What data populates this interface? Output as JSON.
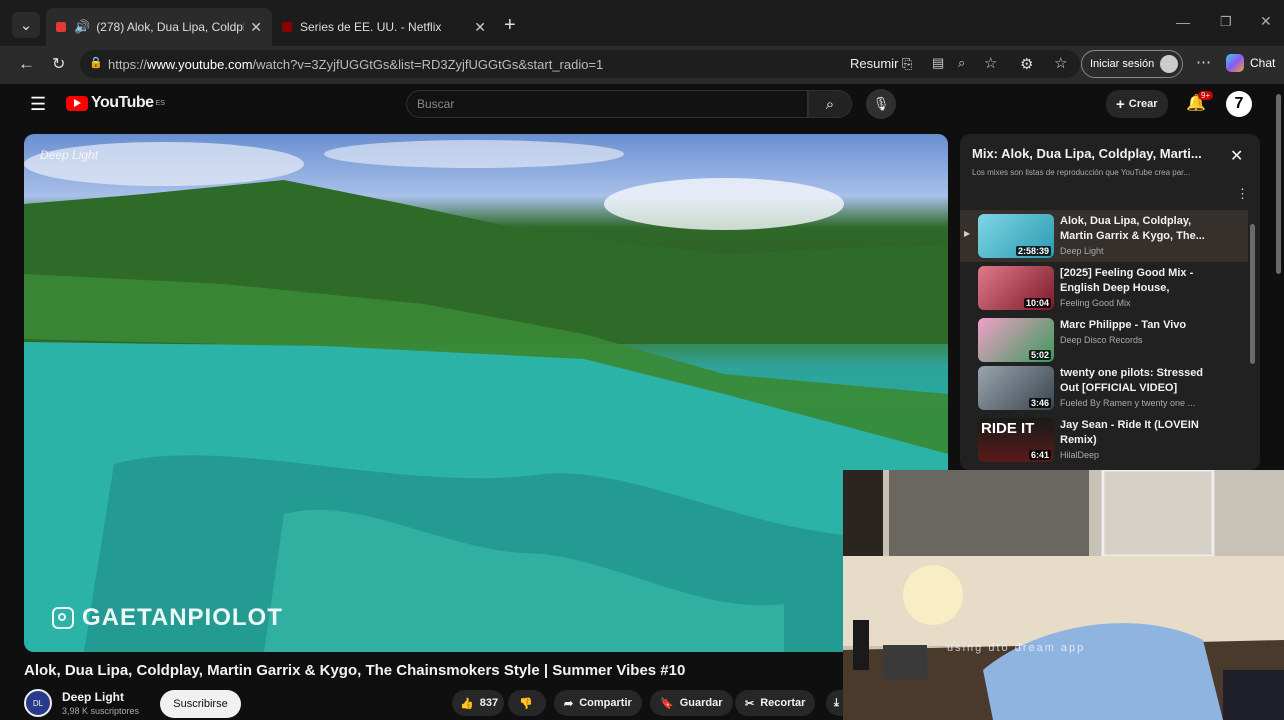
{
  "browser": {
    "tabs": [
      {
        "title": "(278) Alok, Dua Lipa, Coldplay",
        "active": true,
        "favicon_color": "#e53935"
      },
      {
        "title": "Series de EE. UU. - Netflix",
        "active": false,
        "favicon_color": "#8b0000"
      }
    ],
    "url_prefix": "https://",
    "url_host": "www.youtube.com",
    "url_path": "/watch?v=3ZyjfUGGtGs&list=RD3ZyjfUGGtGs&start_radio=1",
    "resumir_label": "Resumir",
    "signin_label": "Iniciar sesión",
    "chat_label": "Chat"
  },
  "youtube": {
    "logo_text": "YouTube",
    "region": "ES",
    "search_placeholder": "Buscar",
    "create_label": "Crear",
    "notif_count": "9+",
    "video": {
      "watermark": "Deep Light",
      "overlay_handle": "GAETANPIOLOT",
      "title": "Alok, Dua Lipa, Coldplay, Martin Garrix & Kygo, The Chainsmokers Style | Summer Vibes #10",
      "channel": "Deep Light",
      "subscribers": "3,98 K suscriptores",
      "subscribe_label": "Suscribirse",
      "likes": "837",
      "share_label": "Compartir",
      "save_label": "Guardar",
      "clip_label": "Recortar"
    },
    "playlist": {
      "title": "Mix: Alok, Dua Lipa, Coldplay, Marti...",
      "subtitle": "Los mixes son listas de reproducción que YouTube crea par...",
      "items": [
        {
          "title": "Alok, Dua Lipa, Coldplay, Martin Garrix & Kygo, The...",
          "channel": "Deep Light",
          "duration": "2:58:39",
          "color": "#3aa8c0",
          "playing": true
        },
        {
          "title": "[2025] Feeling Good Mix - English Deep House, Vocal...",
          "channel": "Feeling Good Mix",
          "duration": "10:04",
          "color": "#b03a4a",
          "playing": false
        },
        {
          "title": "Marc Philippe - Tan Vivo",
          "channel": "Deep Disco Records",
          "duration": "5:02",
          "color": "#c83a7a",
          "playing": false
        },
        {
          "title": "twenty one pilots: Stressed Out [OFFICIAL VIDEO]",
          "channel": "Fueled By Ramen y twenty one ...",
          "duration": "3:46",
          "color": "#5a6a78",
          "playing": false
        },
        {
          "title": "Jay Sean - Ride It (LOVEIN Remix)",
          "channel": "HilalDeep",
          "duration": "6:41",
          "color": "#2a2a2a",
          "thumb_text": "RIDE IT",
          "playing": false
        }
      ]
    }
  },
  "webcam": {
    "caption": "using dto dream app"
  }
}
